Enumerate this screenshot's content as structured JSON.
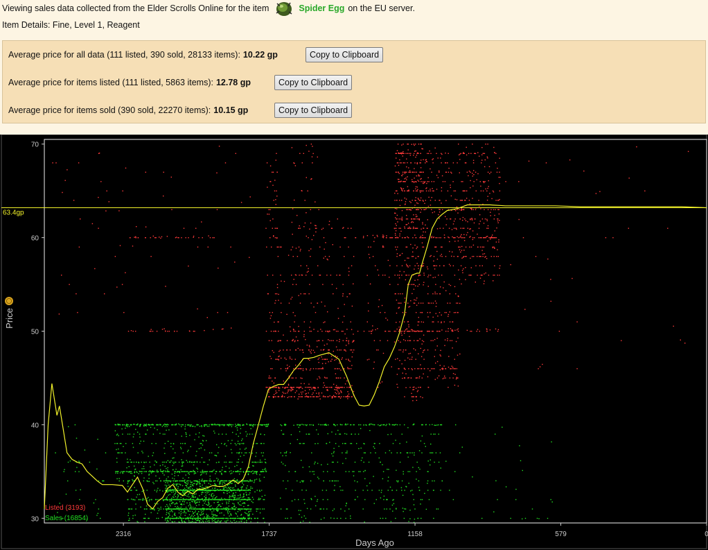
{
  "header": {
    "intro": "Viewing sales data collected from the Elder Scrolls Online for the item",
    "item_name": "Spider Egg",
    "server_text": "on the EU server.",
    "details": "Item Details: Fine, Level 1, Reagent",
    "item_icon": "spider-egg-icon"
  },
  "averages": [
    {
      "label": "Average price for all data (111 listed, 390 sold, 28133 items):",
      "value": "10.22 gp",
      "button": "Copy to Clipboard"
    },
    {
      "label": "Average price for items listed (111 listed, 5863 items):",
      "value": "12.78 gp",
      "button": "Copy to Clipboard"
    },
    {
      "label": "Average price for items sold (390 sold, 22270 items):",
      "value": "10.15 gp",
      "button": "Copy to Clipboard"
    }
  ],
  "colors": {
    "listed": "#ff3a3a",
    "sales": "#22e022",
    "trend": "#f2f22a",
    "background": "#000000",
    "axis_text": "#cccccc"
  },
  "chart_data": {
    "type": "scatter",
    "xlabel": "Days Ago",
    "ylabel": "Price",
    "ylabel_icon": "gold-coin-icon",
    "x_ticks": [
      2316,
      1737,
      1158,
      579,
      0
    ],
    "y_ticks": [
      30,
      40,
      50,
      60,
      70
    ],
    "xlim": [
      2630,
      0
    ],
    "ylim": [
      29.5,
      70.5
    ],
    "x_reversed": true,
    "current_price_label": "63.4gp",
    "current_price": 63.2,
    "legend": [
      {
        "name": "Listed (3193)",
        "color": "#ff3a3a"
      },
      {
        "name": "Sales (16854)",
        "color": "#22e022"
      }
    ],
    "trend": {
      "x": [
        2630,
        2615,
        2600,
        2580,
        2570,
        2555,
        2540,
        2520,
        2500,
        2480,
        2460,
        2440,
        2420,
        2400,
        2360,
        2320,
        2300,
        2280,
        2260,
        2240,
        2220,
        2200,
        2180,
        2160,
        2140,
        2120,
        2100,
        2080,
        2060,
        2040,
        2020,
        2000,
        1980,
        1960,
        1940,
        1920,
        1900,
        1880,
        1860,
        1840,
        1820,
        1800,
        1780,
        1760,
        1740,
        1720,
        1700,
        1680,
        1660,
        1640,
        1620,
        1600,
        1580,
        1560,
        1540,
        1500,
        1460,
        1430,
        1400,
        1380,
        1360,
        1340,
        1320,
        1300,
        1280,
        1260,
        1240,
        1220,
        1200,
        1185,
        1170,
        1150,
        1140,
        1130,
        1110,
        1090,
        1070,
        1050,
        1030,
        1010,
        990,
        970,
        950,
        930,
        900,
        860,
        800,
        700,
        600,
        500,
        400,
        300,
        200,
        100,
        0
      ],
      "y": [
        31,
        40,
        44.4,
        41,
        42,
        39.5,
        37,
        36.3,
        36,
        35.8,
        35,
        34.5,
        34,
        33.6,
        33.6,
        33.5,
        32.8,
        33.6,
        34.4,
        33.2,
        31.5,
        31,
        31.8,
        32.2,
        33.2,
        33.6,
        32.8,
        32.4,
        32.9,
        32.6,
        33.1,
        33.1,
        33.3,
        33.5,
        33.4,
        33.4,
        33.7,
        34.1,
        33.7,
        34.2,
        35.5,
        38,
        40,
        42,
        43.8,
        44.1,
        44.3,
        44.3,
        45,
        45.8,
        46.4,
        47.1,
        47.1,
        47.2,
        47.4,
        47.7,
        47,
        45.2,
        43.1,
        42.1,
        42,
        42.1,
        43.2,
        44.6,
        46.2,
        47.1,
        48.3,
        49.8,
        51.8,
        55,
        56,
        56.2,
        56.2,
        57.2,
        59,
        61,
        62,
        62.5,
        62.9,
        63,
        63.1,
        63.3,
        63.5,
        63.5,
        63.5,
        63.5,
        63.4,
        63.4,
        63.4,
        63.3,
        63.3,
        63.3,
        63.3,
        63.3,
        63.2
      ]
    },
    "listed_clusters": [
      {
        "x": [
          1740,
          1400
        ],
        "y": [
          42.7,
          50.5
        ],
        "density": 330
      },
      {
        "x": [
          1750,
          1400
        ],
        "y": [
          43,
          44
        ],
        "density": 160
      },
      {
        "x": [
          1750,
          1400
        ],
        "y": [
          50,
          62
        ],
        "density": 160
      },
      {
        "x": [
          1750,
          1700
        ],
        "y": [
          60,
          70
        ],
        "density": 30
      },
      {
        "x": [
          1650,
          1540
        ],
        "y": [
          55,
          70
        ],
        "density": 50
      },
      {
        "x": [
          1240,
          1120
        ],
        "y": [
          42.5,
          70
        ],
        "density": 420
      },
      {
        "x": [
          1240,
          1110
        ],
        "y": [
          60,
          70
        ],
        "density": 180
      },
      {
        "x": [
          1110,
          980
        ],
        "y": [
          44,
          70
        ],
        "density": 320
      },
      {
        "x": [
          980,
          820
        ],
        "y": [
          55,
          70
        ],
        "density": 280
      },
      {
        "x": [
          1350,
          1250
        ],
        "y": [
          44,
          60
        ],
        "density": 50
      },
      {
        "x": [
          1400,
          820
        ],
        "y": [
          60,
          60.3
        ],
        "density": 60
      },
      {
        "x": [
          1400,
          820
        ],
        "y": [
          50,
          50.3
        ],
        "density": 50
      },
      {
        "x": [
          2620,
          1800
        ],
        "y": [
          50,
          70
        ],
        "density": 70
      },
      {
        "x": [
          2300,
          1950
        ],
        "y": [
          60,
          60.3
        ],
        "density": 30
      },
      {
        "x": [
          2300,
          1900
        ],
        "y": [
          50,
          50.3
        ],
        "density": 25
      },
      {
        "x": [
          800,
          40
        ],
        "y": [
          45,
          70
        ],
        "density": 35
      }
    ],
    "sales_clusters": [
      {
        "x": [
          2150,
          1810
        ],
        "y": [
          29.5,
          34
        ],
        "density": 1300
      },
      {
        "x": [
          2300,
          1750
        ],
        "y": [
          29.5,
          36
        ],
        "density": 600
      },
      {
        "x": [
          2350,
          1750
        ],
        "y": [
          34,
          40
        ],
        "density": 350
      },
      {
        "x": [
          2350,
          1740
        ],
        "y": [
          39.8,
          40.1
        ],
        "density": 200
      },
      {
        "x": [
          2350,
          1740
        ],
        "y": [
          34.8,
          35.1
        ],
        "density": 100
      },
      {
        "x": [
          2600,
          2380
        ],
        "y": [
          29.5,
          40
        ],
        "density": 40
      },
      {
        "x": [
          1700,
          1050
        ],
        "y": [
          29.5,
          40
        ],
        "density": 380
      },
      {
        "x": [
          1700,
          1050
        ],
        "y": [
          39.9,
          40.1
        ],
        "density": 90
      },
      {
        "x": [
          1050,
          600
        ],
        "y": [
          29.5,
          40
        ],
        "density": 30
      }
    ]
  }
}
